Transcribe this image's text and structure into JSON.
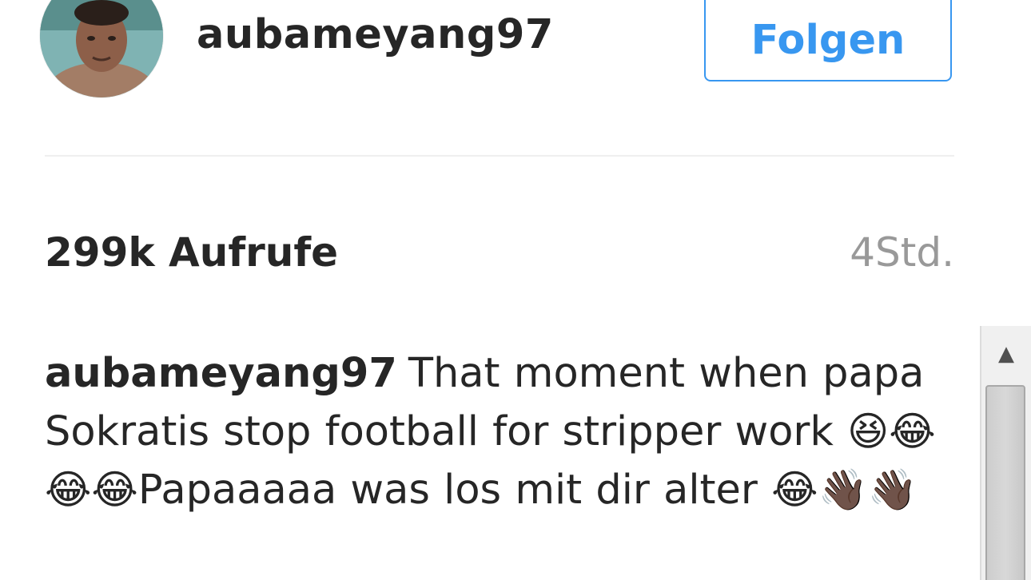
{
  "header": {
    "username": "aubameyang97",
    "follow_label": "Folgen"
  },
  "stats": {
    "views": "299k Aufrufe",
    "time_ago": "4Std."
  },
  "caption": {
    "author": "aubameyang97",
    "text_part1": "That moment when papa Sokratis stop football for stripper work ",
    "emojis1": "😆😂😂😂",
    "text_part2": "Papaaaaa was los mit dir alter ",
    "emojis2": "😂👋🏿👋🏿"
  },
  "colors": {
    "accent": "#3897f0",
    "text": "#262626",
    "muted": "#999999",
    "divider": "#efefef"
  },
  "icons": {
    "scroll_up": "scroll-up-arrow-icon"
  }
}
